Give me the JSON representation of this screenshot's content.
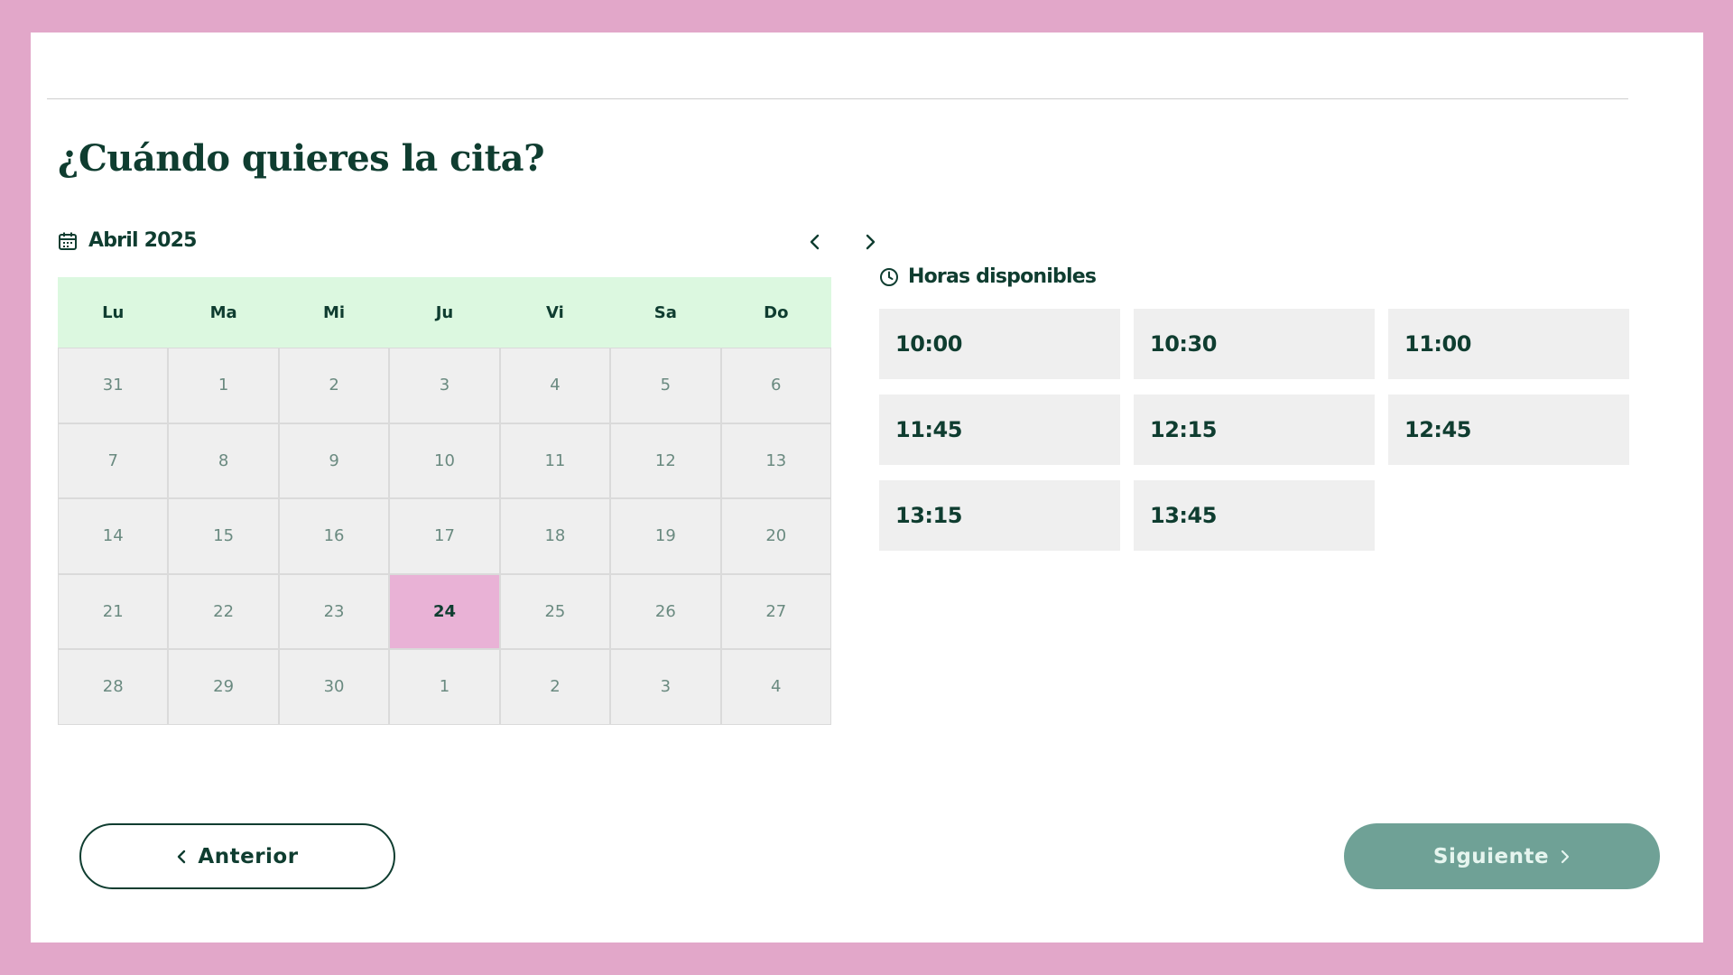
{
  "page": {
    "title": "¿Cuándo quieres la cita?"
  },
  "calendar": {
    "month_label": "Abril 2025",
    "weekdays": [
      "Lu",
      "Ma",
      "Mi",
      "Ju",
      "Vi",
      "Sa",
      "Do"
    ],
    "days": [
      "31",
      "1",
      "2",
      "3",
      "4",
      "5",
      "6",
      "7",
      "8",
      "9",
      "10",
      "11",
      "12",
      "13",
      "14",
      "15",
      "16",
      "17",
      "18",
      "19",
      "20",
      "21",
      "22",
      "23",
      "24",
      "25",
      "26",
      "27",
      "28",
      "29",
      "30",
      "1",
      "2",
      "3",
      "4"
    ],
    "selected_day": "24"
  },
  "hours": {
    "label": "Horas disponibles",
    "slots": [
      "10:00",
      "10:30",
      "11:00",
      "11:45",
      "12:15",
      "12:45",
      "13:15",
      "13:45"
    ]
  },
  "footer": {
    "prev_label": "Anterior",
    "next_label": "Siguiente"
  },
  "colors": {
    "frame": "#e2a7c9",
    "primary": "#0f3d30",
    "weekday_bg": "#dcf8e0",
    "selected_bg": "#e9b2d6",
    "next_button_bg": "#6fa196"
  },
  "icons": {
    "month": "calendar-icon",
    "prev": "chevron-left-icon",
    "next": "chevron-right-icon",
    "hours": "clock-icon"
  }
}
